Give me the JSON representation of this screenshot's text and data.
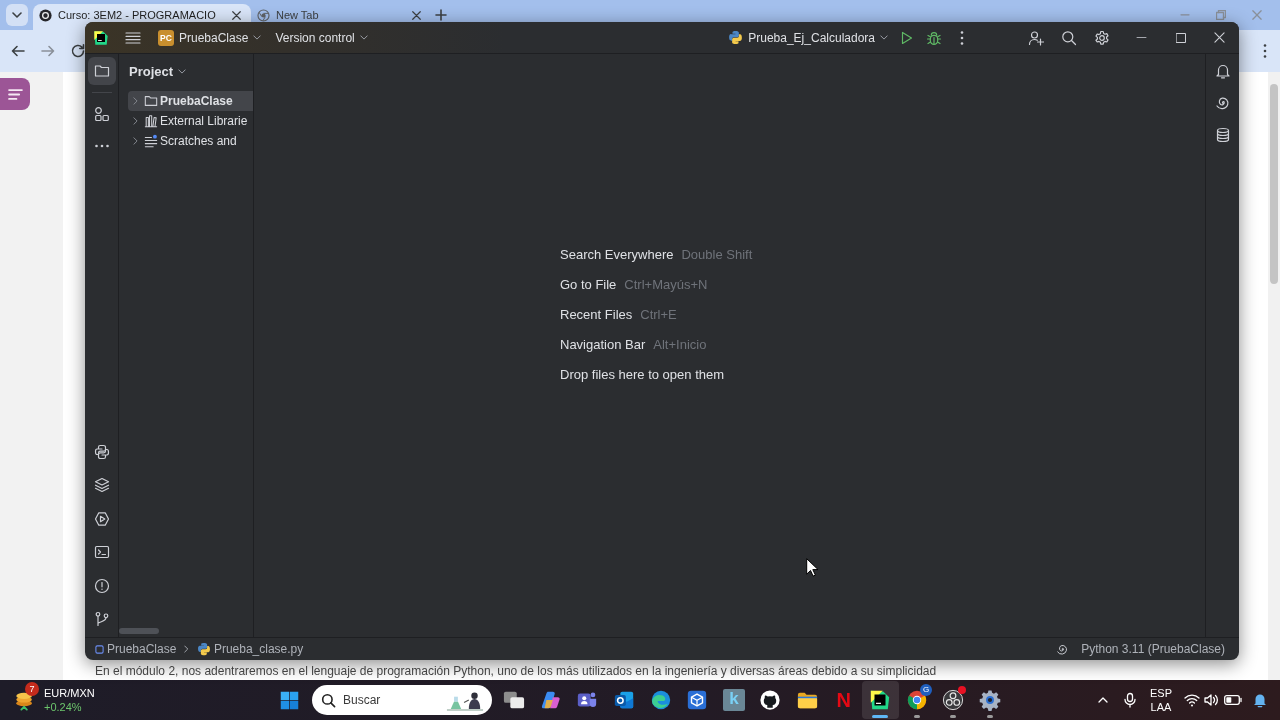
{
  "browser": {
    "tabs": [
      {
        "kind": "site",
        "title": "Curso: 3EM2 - PROGRAMACIO",
        "selected": true
      },
      {
        "kind": "newtab",
        "title": "New Tab",
        "selected": false
      }
    ],
    "nav_buttons": [
      {
        "kind": "back",
        "disabled": false
      },
      {
        "kind": "forward",
        "disabled": true
      },
      {
        "kind": "reload",
        "disabled": false
      }
    ],
    "page_text": "En el módulo 2, nos adentraremos en el lenguaje de programación Python, uno de los más utilizados en la ingeniería y diversas áreas debido a su simplicidad"
  },
  "ide": {
    "title_bar": {
      "project": {
        "badge": "PC",
        "name": "PruebaClase"
      },
      "vcs": "Version control",
      "run_configuration": "Prueba_Ej_Calculadora"
    },
    "left_toolbar": {
      "top": [
        {
          "kind": "project",
          "selected": true
        },
        {
          "kind": "structure",
          "selected": false
        },
        {
          "kind": "more",
          "selected": false
        }
      ],
      "bottom": [
        {
          "kind": "python-console",
          "selected": false
        },
        {
          "kind": "python-packages",
          "selected": false
        },
        {
          "kind": "services",
          "selected": false
        },
        {
          "kind": "terminal",
          "selected": false
        },
        {
          "kind": "problems",
          "selected": false
        },
        {
          "kind": "git",
          "selected": false
        }
      ]
    },
    "project_panel": {
      "title": "Project",
      "items": [
        {
          "kind": "module",
          "label": "PruebaClase",
          "selected": true,
          "expanded": false
        },
        {
          "kind": "libraries",
          "label": "External Librarie",
          "selected": false,
          "expanded": false
        },
        {
          "kind": "scratches",
          "label": "Scratches and",
          "selected": false,
          "expanded": false
        }
      ]
    },
    "empty_state": [
      {
        "action": "Search Everywhere",
        "shortcut": "Double Shift"
      },
      {
        "action": "Go to File",
        "shortcut": "Ctrl+Mayús+N"
      },
      {
        "action": "Recent Files",
        "shortcut": "Ctrl+E"
      },
      {
        "action": "Navigation Bar",
        "shortcut": "Alt+Inicio"
      },
      {
        "action": "Drop files here to open them"
      }
    ],
    "right_toolbar": [
      {
        "kind": "notifications"
      },
      {
        "kind": "ai-assistant"
      },
      {
        "kind": "database"
      }
    ],
    "status_bar": {
      "breadcrumbs": [
        {
          "kind": "module",
          "label": "PruebaClase"
        },
        {
          "kind": "python-file",
          "label": "Prueba_clase.py"
        }
      ],
      "interpreter": "Python 3.11 (PruebaClase)"
    }
  },
  "taskbar": {
    "widget": {
      "badge": "7",
      "title": "EUR/MXN",
      "change": "+0.24%"
    },
    "search": {
      "placeholder": "Buscar"
    },
    "apps": [
      {
        "kind": "task-view",
        "running": false,
        "selected": false,
        "alert": false
      },
      {
        "kind": "copilot",
        "running": false,
        "selected": false,
        "alert": false
      },
      {
        "kind": "teams",
        "running": false,
        "selected": false,
        "alert": false
      },
      {
        "kind": "outlook",
        "running": false,
        "selected": false,
        "alert": false
      },
      {
        "kind": "edge",
        "running": false,
        "selected": false,
        "alert": false
      },
      {
        "kind": "cube-app",
        "running": false,
        "selected": false,
        "alert": false
      },
      {
        "kind": "k-app",
        "letter": "k",
        "running": false,
        "selected": false,
        "alert": false
      },
      {
        "kind": "github",
        "running": false,
        "selected": false,
        "alert": false
      },
      {
        "kind": "explorer",
        "running": false,
        "selected": false,
        "alert": false
      },
      {
        "kind": "netflix",
        "letter": "N",
        "running": false,
        "selected": false,
        "alert": false
      },
      {
        "kind": "pycharm",
        "running": true,
        "selected": true,
        "alert": false
      },
      {
        "kind": "chrome",
        "badge": "G",
        "running": true,
        "selected": false,
        "alert": false
      },
      {
        "kind": "obs",
        "running": true,
        "selected": false,
        "alert": true
      },
      {
        "kind": "settings",
        "running": true,
        "selected": false,
        "alert": false
      }
    ],
    "tray": {
      "language": "ESP",
      "layout": "LAA"
    }
  }
}
